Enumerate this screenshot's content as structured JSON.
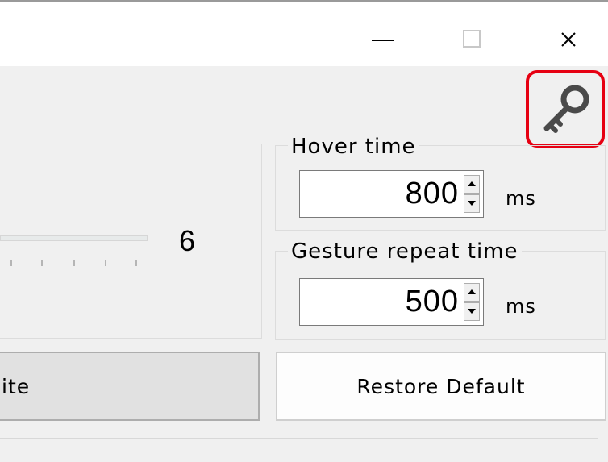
{
  "window": {
    "minimize_icon": "minimize-icon",
    "maximize_icon": "maximize-icon",
    "close_icon": "close-icon"
  },
  "toolbar": {
    "key_icon": "key-icon",
    "highlight_color": "#e60012"
  },
  "slider": {
    "value": "6"
  },
  "hover_time": {
    "label": "Hover time",
    "value": "800",
    "unit": "ms"
  },
  "gesture_repeat_time": {
    "label": "Gesture repeat time",
    "value": "500",
    "unit": "ms"
  },
  "buttons": {
    "left_partial_label": "ite",
    "restore_default_label": "Restore Default"
  }
}
